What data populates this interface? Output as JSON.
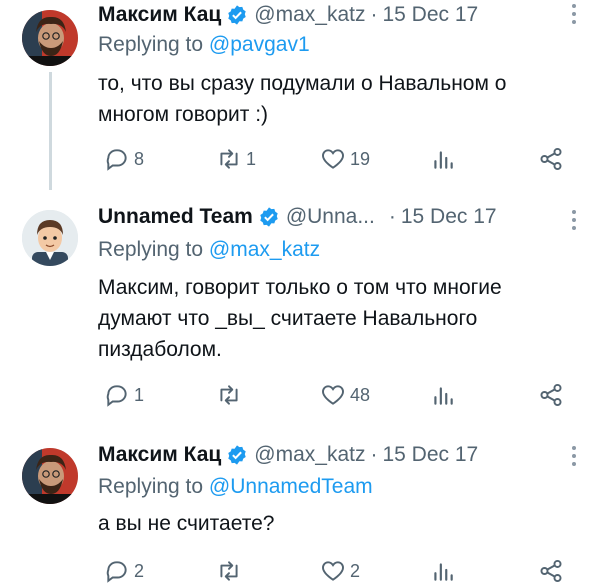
{
  "tweets": [
    {
      "name": "Максим Кац",
      "handle": "@max_katz",
      "separator": "·",
      "date": "15 Dec 17",
      "replying_prefix": "Replying to",
      "replying_to": "@pavgav1",
      "text": "то, что вы сразу подумали о Навальном о многом говорит :)",
      "replies": "8",
      "retweets": "1",
      "likes": "19",
      "avatar_icon": "bearded-man-avatar"
    },
    {
      "name": "Unnamed Team",
      "handle": "@Unna...",
      "separator": "·",
      "date": "15 Dec 17",
      "replying_prefix": "Replying to",
      "replying_to": "@max_katz",
      "text": "Максим, говорит только о том что многие думают что _вы_ считаете Навального пиздаболом.",
      "replies": "1",
      "retweets": "",
      "likes": "48",
      "avatar_icon": "cartoon-man-avatar"
    },
    {
      "name": "Максим Кац",
      "handle": "@max_katz",
      "separator": "·",
      "date": "15 Dec 17",
      "replying_prefix": "Replying to",
      "replying_to": "@UnnamedTeam",
      "text": "а вы не считаете?",
      "replies": "2",
      "retweets": "",
      "likes": "2",
      "avatar_icon": "bearded-man-avatar"
    }
  ],
  "colors": {
    "accent": "#1d9bf0",
    "secondary_text": "#536471",
    "thread_line": "#cfd9de"
  }
}
